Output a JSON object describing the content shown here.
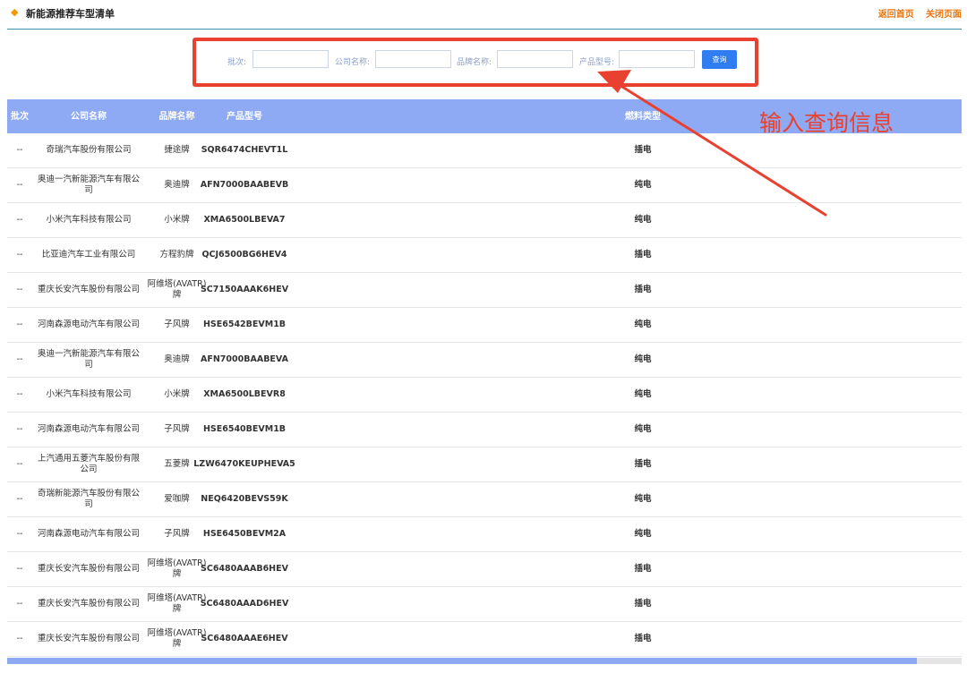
{
  "header": {
    "title": "新能源推荐车型清单",
    "link_home": "返回首页",
    "link_close": "关闭页面"
  },
  "search": {
    "batch_label": "批次:",
    "company_label": "公司名称:",
    "brand_label": "品牌名称:",
    "model_label": "产品型号:",
    "batch_value": "",
    "company_value": "",
    "brand_value": "",
    "model_value": "",
    "query_button": "查询"
  },
  "annotation": {
    "text": "输入查询信息"
  },
  "table": {
    "headers": {
      "batch": "批次",
      "company": "公司名称",
      "brand": "品牌名称",
      "model": "产品型号",
      "fuel": "燃料类型"
    },
    "rows": [
      {
        "batch": "--",
        "company": "奇瑞汽车股份有限公司",
        "brand": "捷途牌",
        "model": "SQR6474CHEVT1L",
        "fuel": "插电"
      },
      {
        "batch": "--",
        "company": "奥迪一汽新能源汽车有限公司",
        "brand": "奥迪牌",
        "model": "AFN7000BAABEVB",
        "fuel": "纯电"
      },
      {
        "batch": "--",
        "company": "小米汽车科技有限公司",
        "brand": "小米牌",
        "model": "XMA6500LBEVA7",
        "fuel": "纯电"
      },
      {
        "batch": "--",
        "company": "比亚迪汽车工业有限公司",
        "brand": "方程豹牌",
        "model": "QCJ6500BG6HEV4",
        "fuel": "插电"
      },
      {
        "batch": "--",
        "company": "重庆长安汽车股份有限公司",
        "brand": "阿维塔(AVATR)牌",
        "model": "SC7150AAAK6HEV",
        "fuel": "插电"
      },
      {
        "batch": "--",
        "company": "河南森源电动汽车有限公司",
        "brand": "子风牌",
        "model": "HSE6542BEVM1B",
        "fuel": "纯电"
      },
      {
        "batch": "--",
        "company": "奥迪一汽新能源汽车有限公司",
        "brand": "奥迪牌",
        "model": "AFN7000BAABEVA",
        "fuel": "纯电"
      },
      {
        "batch": "--",
        "company": "小米汽车科技有限公司",
        "brand": "小米牌",
        "model": "XMA6500LBEVR8",
        "fuel": "纯电"
      },
      {
        "batch": "--",
        "company": "河南森源电动汽车有限公司",
        "brand": "子风牌",
        "model": "HSE6540BEVM1B",
        "fuel": "纯电"
      },
      {
        "batch": "--",
        "company": "上汽通用五菱汽车股份有限公司",
        "brand": "五菱牌",
        "model": "LZW6470KEUPHEVA5",
        "fuel": "插电"
      },
      {
        "batch": "--",
        "company": "奇瑞新能源汽车股份有限公司",
        "brand": "爱咖牌",
        "model": "NEQ6420BEVS59K",
        "fuel": "纯电"
      },
      {
        "batch": "--",
        "company": "河南森源电动汽车有限公司",
        "brand": "子风牌",
        "model": "HSE6450BEVM2A",
        "fuel": "纯电"
      },
      {
        "batch": "--",
        "company": "重庆长安汽车股份有限公司",
        "brand": "阿维塔(AVATR)牌",
        "model": "SC6480AAAB6HEV",
        "fuel": "插电"
      },
      {
        "batch": "--",
        "company": "重庆长安汽车股份有限公司",
        "brand": "阿维塔(AVATR)牌",
        "model": "SC6480AAAD6HEV",
        "fuel": "插电"
      },
      {
        "batch": "--",
        "company": "重庆长安汽车股份有限公司",
        "brand": "阿维塔(AVATR)牌",
        "model": "SC6480AAAE6HEV",
        "fuel": "插电"
      }
    ]
  },
  "colors": {
    "accent": "#2f7df0",
    "header_bg": "#8eaaf5",
    "annotation": "#e8412f",
    "link": "#e8750f"
  }
}
